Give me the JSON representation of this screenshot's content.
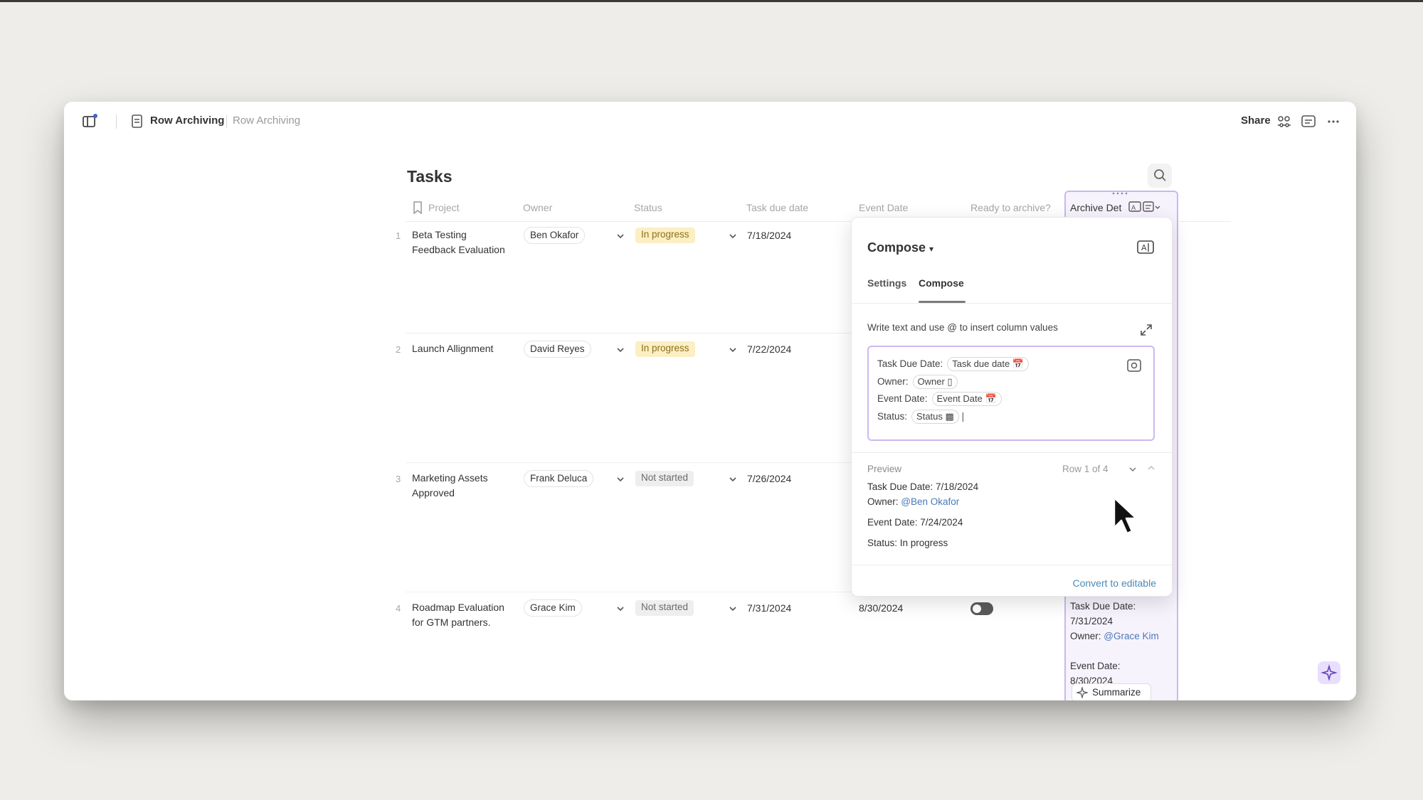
{
  "titlebar": {
    "doc_title": "Row Archiving",
    "doc_subtitle": "Row Archiving",
    "share_label": "Share"
  },
  "table": {
    "title": "Tasks",
    "columns": [
      "Project",
      "Owner",
      "Status",
      "Task due date",
      "Event Date",
      "Ready to archive?",
      "Archive Det"
    ],
    "rows": [
      {
        "num": "1",
        "project_l1": "Beta Testing",
        "project_l2": "Feedback Evaluation",
        "owner": "Ben Okafor",
        "status": "In progress",
        "due": "7/18/2024"
      },
      {
        "num": "2",
        "project_l1": "Launch Allignment",
        "project_l2": "",
        "owner": "David Reyes",
        "status": "In progress",
        "due": "7/22/2024"
      },
      {
        "num": "3",
        "project_l1": "Marketing Assets",
        "project_l2": "Approved",
        "owner": "Frank Deluca",
        "status": "Not started",
        "due": "7/26/2024"
      },
      {
        "num": "4",
        "project_l1": "Roadmap Evaluation",
        "project_l2": "for GTM partners.",
        "owner": "Grace Kim",
        "status": "Not started",
        "due": "7/31/2024",
        "event": "8/30/2024",
        "ready": false
      }
    ],
    "archive_cell_row4": {
      "l1": "Task Due Date:",
      "l2": "7/31/2024",
      "owner_label": "Owner:",
      "owner_link": "@Grace Kim",
      "l4": "Event Date:",
      "l5": "8/30/2024"
    },
    "summarize_label": "Summarize"
  },
  "popup": {
    "title": "Compose",
    "tabs": [
      "Settings",
      "Compose"
    ],
    "active_tab": "Compose",
    "hint": "Write text and use @ to insert column values",
    "template": [
      {
        "label": "Task Due Date:",
        "token": "Task due date"
      },
      {
        "label": "Owner:",
        "token": "Owner"
      },
      {
        "label": "Event Date:",
        "token": "Event Date"
      },
      {
        "label": "Status:",
        "token": "Status"
      }
    ],
    "preview_label": "Preview",
    "row_of": "Row 1 of 4",
    "preview": {
      "due": "Task Due Date: 7/18/2024",
      "owner_label": "Owner:",
      "owner_link": "@Ben Okafor",
      "event": "Event Date: 7/24/2024",
      "status": "Status: In progress"
    },
    "convert_label": "Convert to editable"
  },
  "colors": {
    "accent_purple": "#c9b8ef",
    "in_progress_bg": "#fbefc3",
    "link_blue": "#4a78b8"
  }
}
